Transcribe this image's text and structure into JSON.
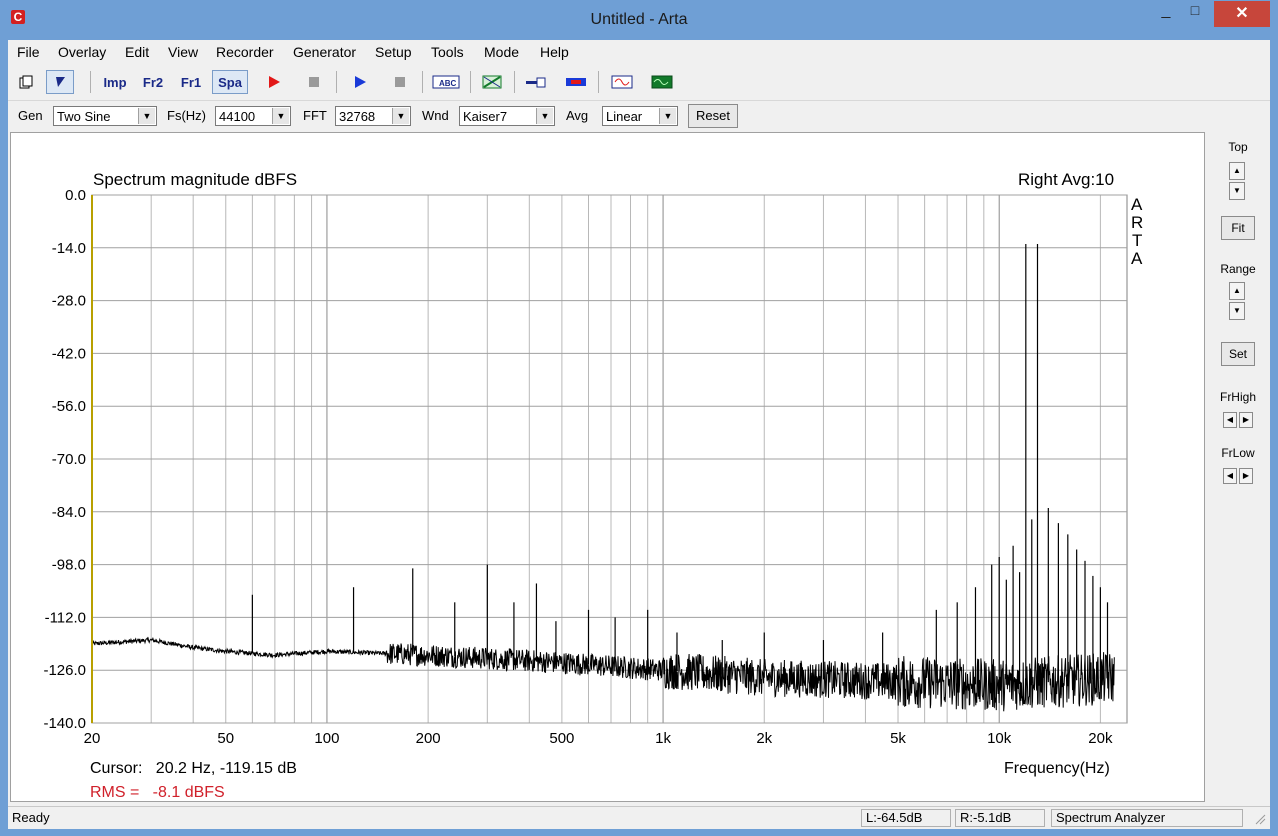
{
  "window": {
    "title": "Untitled - Arta",
    "minimize_glyph": "_",
    "maximize_glyph": "□",
    "close_glyph": "✕",
    "app_icon_letter": "C"
  },
  "menu": [
    "File",
    "Overlay",
    "Edit",
    "View",
    "Recorder",
    "Generator",
    "Setup",
    "Tools",
    "Mode",
    "Help"
  ],
  "toolbar": {
    "imp_label": "Imp",
    "fr2_label": "Fr2",
    "fr1_label": "Fr1",
    "spa_label": "Spa",
    "abc_label": "ABC"
  },
  "gen_bar": {
    "gen_label": "Gen",
    "gen_value": "Two Sine",
    "fs_label": "Fs(Hz)",
    "fs_value": "44100",
    "fft_label": "FFT",
    "fft_value": "32768",
    "wnd_label": "Wnd",
    "wnd_value": "Kaiser7",
    "avg_label": "Avg",
    "avg_value": "Linear",
    "reset_label": "Reset"
  },
  "side_panel": {
    "top_label": "Top",
    "fit_label": "Fit",
    "range_label": "Range",
    "set_label": "Set",
    "frhigh_label": "FrHigh",
    "frlow_label": "FrLow"
  },
  "plot": {
    "cursor_text": "Cursor:   20.2 Hz, -119.15 dB",
    "rms_text": "RMS =   -8.1 dBFS",
    "channel_text": "Right  Avg:10",
    "arta_letters": [
      "A",
      "R",
      "T",
      "A"
    ]
  },
  "chart_data": {
    "type": "line",
    "title": "Spectrum magnitude dBFS",
    "xlabel": "Frequency(Hz)",
    "ylabel": "",
    "x_scale": "log",
    "xlim": [
      20,
      24000
    ],
    "ylim": [
      -140,
      0
    ],
    "y_ticks": [
      "0.0",
      "-14.0",
      "-28.0",
      "-42.0",
      "-56.0",
      "-70.0",
      "-84.0",
      "-98.0",
      "-112.0",
      "-126.0",
      "-140.0"
    ],
    "x_ticks": [
      {
        "value": 20,
        "label": "20"
      },
      {
        "value": 50,
        "label": "50"
      },
      {
        "value": 100,
        "label": "100"
      },
      {
        "value": 200,
        "label": "200"
      },
      {
        "value": 500,
        "label": "500"
      },
      {
        "value": 1000,
        "label": "1k"
      },
      {
        "value": 2000,
        "label": "2k"
      },
      {
        "value": 5000,
        "label": "5k"
      },
      {
        "value": 10000,
        "label": "10k"
      },
      {
        "value": 20000,
        "label": "20k"
      }
    ],
    "grid": true,
    "noise_floor": [
      [
        20,
        -119
      ],
      [
        30,
        -118
      ],
      [
        40,
        -120
      ],
      [
        50,
        -121
      ],
      [
        70,
        -122
      ],
      [
        100,
        -121
      ],
      [
        200,
        -122
      ],
      [
        500,
        -124
      ],
      [
        1000,
        -126
      ],
      [
        2000,
        -128
      ],
      [
        5000,
        -129
      ],
      [
        10000,
        -130
      ],
      [
        15000,
        -129
      ],
      [
        22000,
        -128
      ]
    ],
    "peaks": [
      [
        48,
        -121
      ],
      [
        60,
        -106
      ],
      [
        120,
        -104
      ],
      [
        180,
        -99
      ],
      [
        240,
        -108
      ],
      [
        300,
        -98
      ],
      [
        360,
        -108
      ],
      [
        420,
        -103
      ],
      [
        480,
        -113
      ],
      [
        600,
        -110
      ],
      [
        720,
        -112
      ],
      [
        900,
        -110
      ],
      [
        1100,
        -116
      ],
      [
        1500,
        -118
      ],
      [
        2000,
        -116
      ],
      [
        3000,
        -118
      ],
      [
        4500,
        -116
      ],
      [
        6500,
        -110
      ],
      [
        7500,
        -108
      ],
      [
        8500,
        -104
      ],
      [
        9500,
        -98
      ],
      [
        10000,
        -96
      ],
      [
        10500,
        -102
      ],
      [
        11000,
        -93
      ],
      [
        11500,
        -100
      ],
      [
        12000,
        -13
      ],
      [
        12500,
        -86
      ],
      [
        13000,
        -13
      ],
      [
        14000,
        -83
      ],
      [
        15000,
        -87
      ],
      [
        16000,
        -90
      ],
      [
        17000,
        -94
      ],
      [
        18000,
        -97
      ],
      [
        19000,
        -101
      ],
      [
        20000,
        -104
      ],
      [
        21000,
        -108
      ]
    ]
  },
  "status": {
    "ready": "Ready",
    "left_level": "L:-64.5dB",
    "right_level": "R:-5.1dB",
    "mode": "Spectrum Analyzer"
  }
}
